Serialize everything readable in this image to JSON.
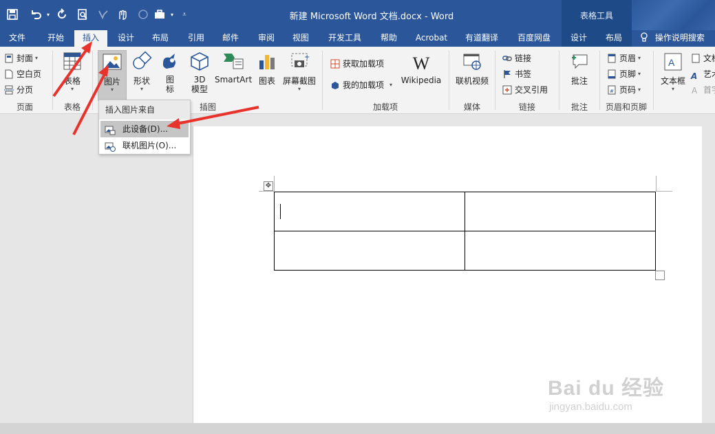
{
  "window": {
    "title": "新建 Microsoft Word 文档.docx  -  Word",
    "context_tools": "表格工具"
  },
  "tabs": [
    {
      "label": "文件"
    },
    {
      "label": "开始"
    },
    {
      "label": "插入"
    },
    {
      "label": "设计"
    },
    {
      "label": "布局"
    },
    {
      "label": "引用"
    },
    {
      "label": "邮件"
    },
    {
      "label": "审阅"
    },
    {
      "label": "视图"
    },
    {
      "label": "开发工具"
    },
    {
      "label": "帮助"
    },
    {
      "label": "Acrobat"
    },
    {
      "label": "有道翻译"
    },
    {
      "label": "百度网盘"
    },
    {
      "label": "设计"
    },
    {
      "label": "布局"
    }
  ],
  "tell_me": "操作说明搜索",
  "ribbon": {
    "pages_group": {
      "label": "页面",
      "cover": "封面",
      "blank": "空白页",
      "page_break": "分页"
    },
    "tables_group": {
      "label": "表格",
      "table": "表格"
    },
    "illustrations_group": {
      "label": "插图",
      "pictures": "图片",
      "shapes": "形状",
      "icons_l1": "图",
      "icons_l2": "标",
      "model3d_l1": "3D",
      "model3d_l2": "模型",
      "smartart": "SmartArt",
      "chart": "图表",
      "screenshot": "屏幕截图"
    },
    "addins_group": {
      "label": "加载项",
      "get_addins": "获取加载项",
      "my_addins": "我的加载项",
      "wikipedia": "Wikipedia"
    },
    "media_group": {
      "label": "媒体",
      "online_video": "联机视频"
    },
    "links_group": {
      "label": "链接",
      "link": "链接",
      "bookmark": "书签",
      "cross_ref": "交叉引用"
    },
    "comments_group": {
      "label": "批注",
      "comment": "批注"
    },
    "header_footer_group": {
      "label": "页眉和页脚",
      "header": "页眉",
      "footer": "页脚",
      "page_number": "页码"
    },
    "text_group": {
      "textbox": "文本框",
      "item1": "文档",
      "item2": "艺术",
      "item3": "首字"
    }
  },
  "dropdown": {
    "header": "插入图片来自",
    "items": [
      {
        "label": "此设备(D)..."
      },
      {
        "label": "联机图片(O)..."
      }
    ]
  },
  "watermark": {
    "brand": "Bai du 经验",
    "url": "jingyan.baidu.com"
  },
  "colors": {
    "accent": "#2b579a",
    "annotation": "#e8322c"
  }
}
